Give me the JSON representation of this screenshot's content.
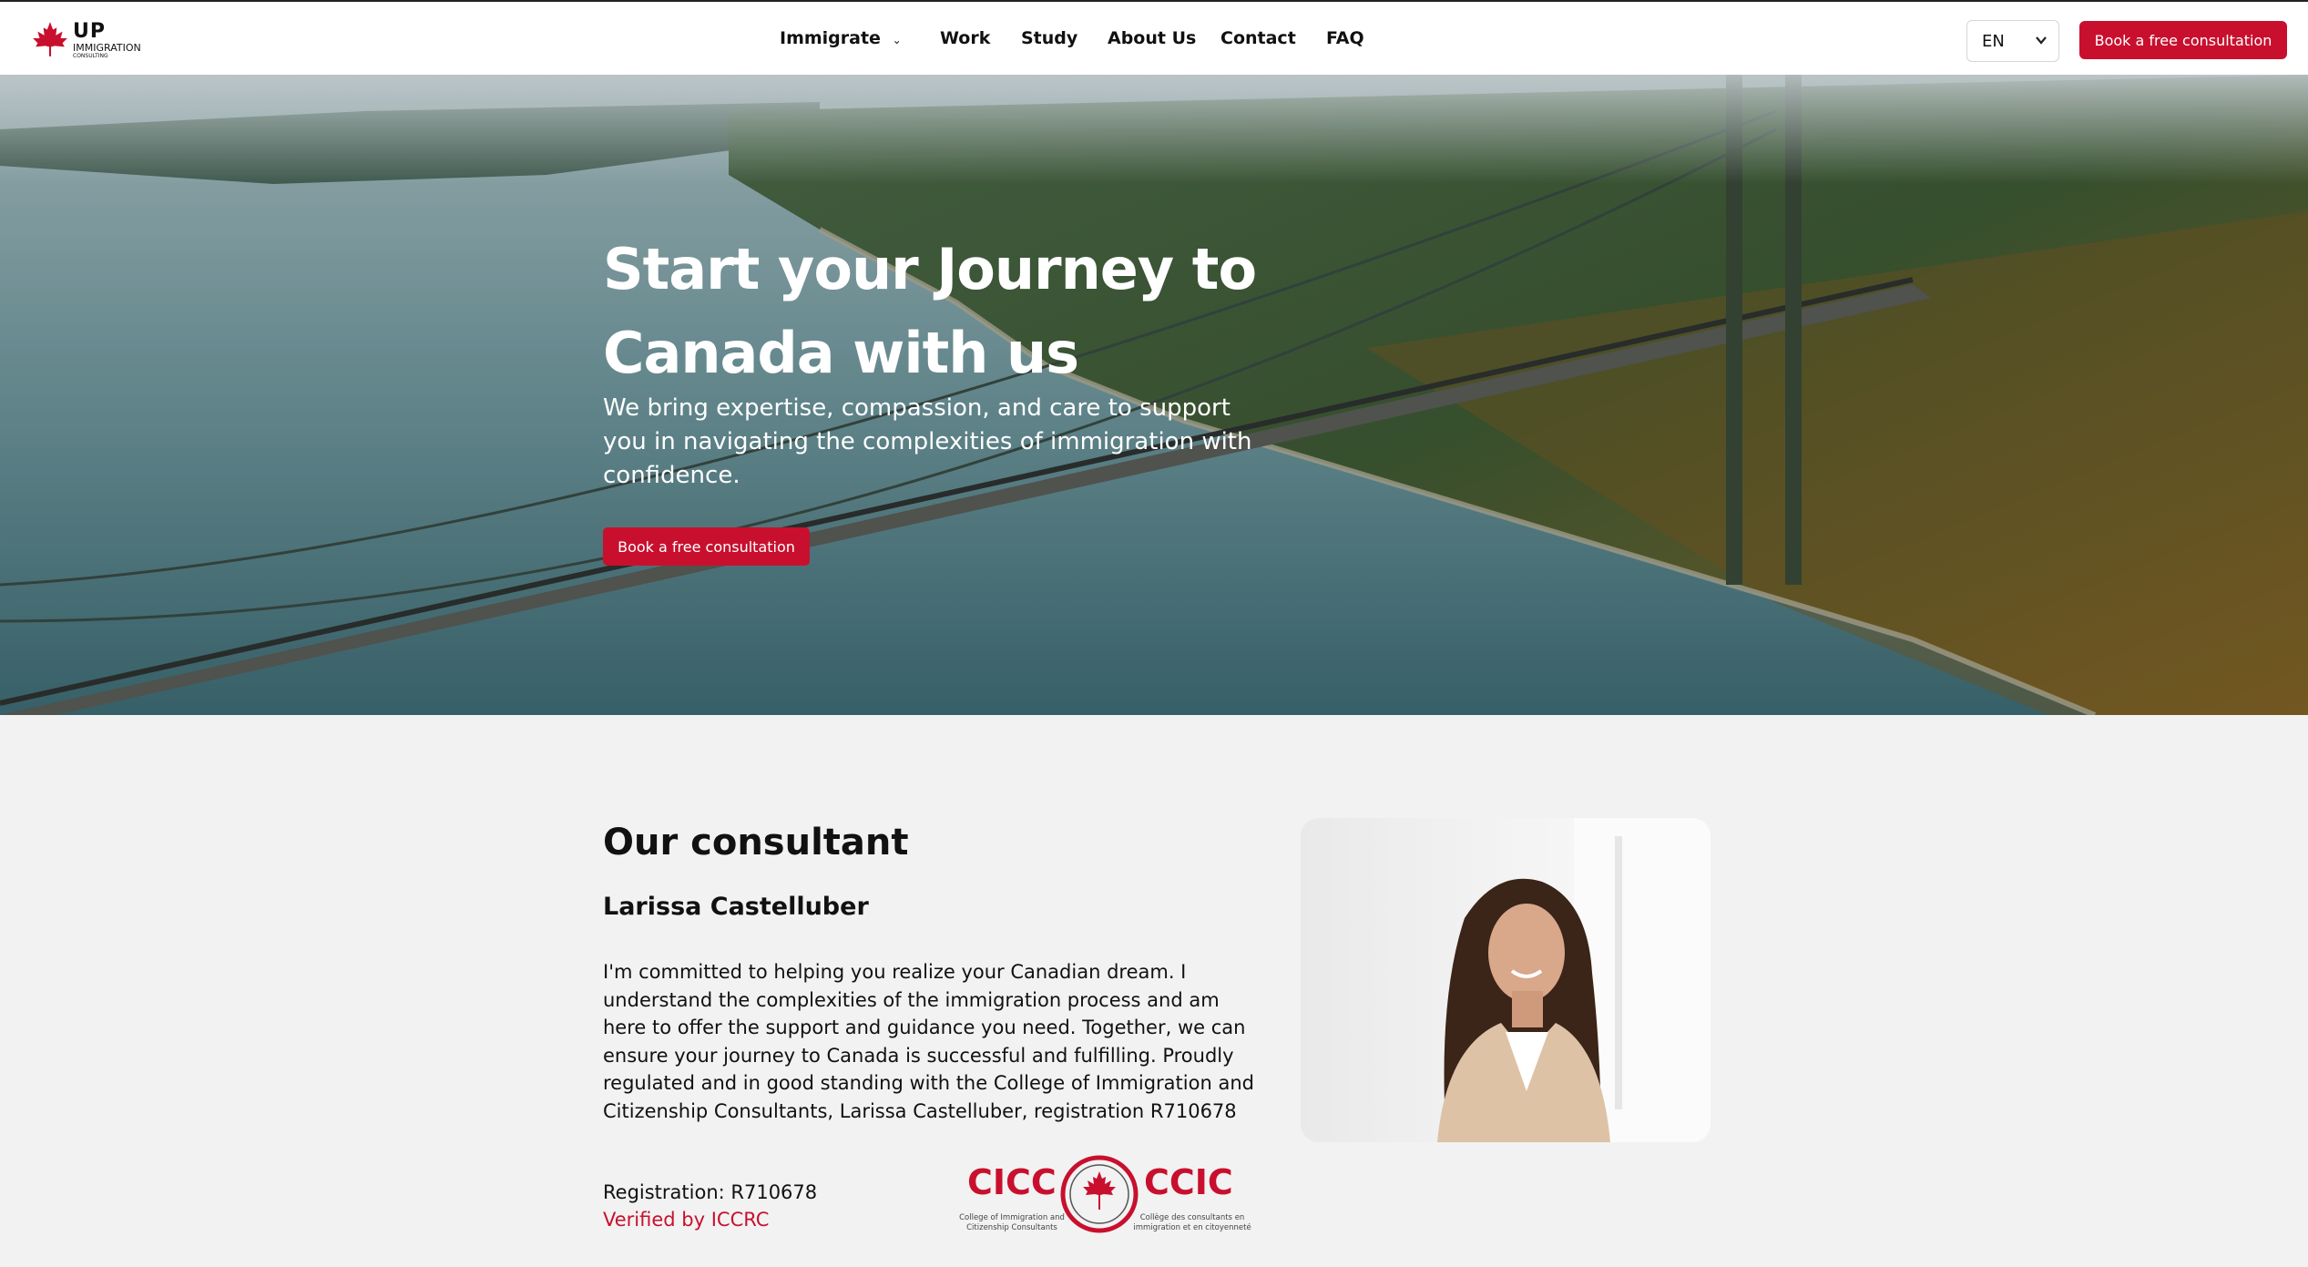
{
  "nav": {
    "logo": {
      "brand": "UP",
      "line1": "IMMIGRATION",
      "line2": "CONSULTING"
    },
    "items": [
      {
        "label": "Immigrate",
        "dropdown": true
      },
      {
        "label": "Work"
      },
      {
        "label": "Study"
      },
      {
        "label": "About Us"
      },
      {
        "label": "Contact"
      },
      {
        "label": "FAQ"
      }
    ],
    "language": {
      "selected": "EN"
    },
    "cta_label": "Book a free consultation"
  },
  "hero": {
    "title": "Start your Journey to Canada with us",
    "subtitle": "We bring expertise, compassion, and care to support you in navigating the complexities of immigration with confidence.",
    "cta_label": "Book a free consultation"
  },
  "consultant": {
    "section_title": "Our consultant",
    "name": "Larissa Castelluber",
    "bio": "I'm committed to helping you realize your Canadian dream. I understand the complexities of the immigration process and am here to offer the support and guidance you need. Together, we can ensure your journey to Canada is successful and fulfilling. Proudly regulated and in good standing with the College of Immigration and Citizenship Consultants, Larissa Castelluber, registration R710678",
    "registration": "Registration: R710678",
    "verified_label": "Verified by ICCRC",
    "badge": {
      "left": "CICC",
      "right": "CCIC",
      "left_sub": "College of Immigration and Citizenship Consultants",
      "right_sub": "Collège des consultants en immigration et en citoyenneté"
    }
  },
  "colors": {
    "accent": "#c8102e",
    "background": "#f2f2f2",
    "nav_bg": "#ffffff"
  }
}
